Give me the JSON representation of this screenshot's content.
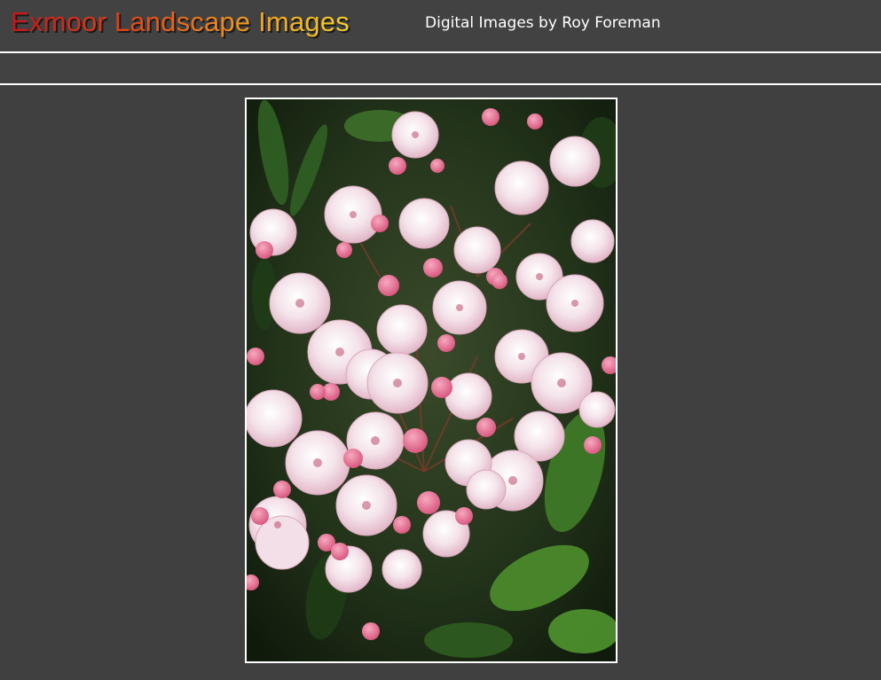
{
  "header": {
    "site_title": "Exmoor Landscape Images",
    "subtitle": "Digital Images by Roy Foreman"
  },
  "colors": {
    "page_background": "#404040",
    "title_gradient_start": "#c8141a",
    "title_gradient_end": "#f5d02a",
    "divider": "#ffffff"
  },
  "main": {
    "photo_subject": "pink-white-flower-cluster-image"
  }
}
